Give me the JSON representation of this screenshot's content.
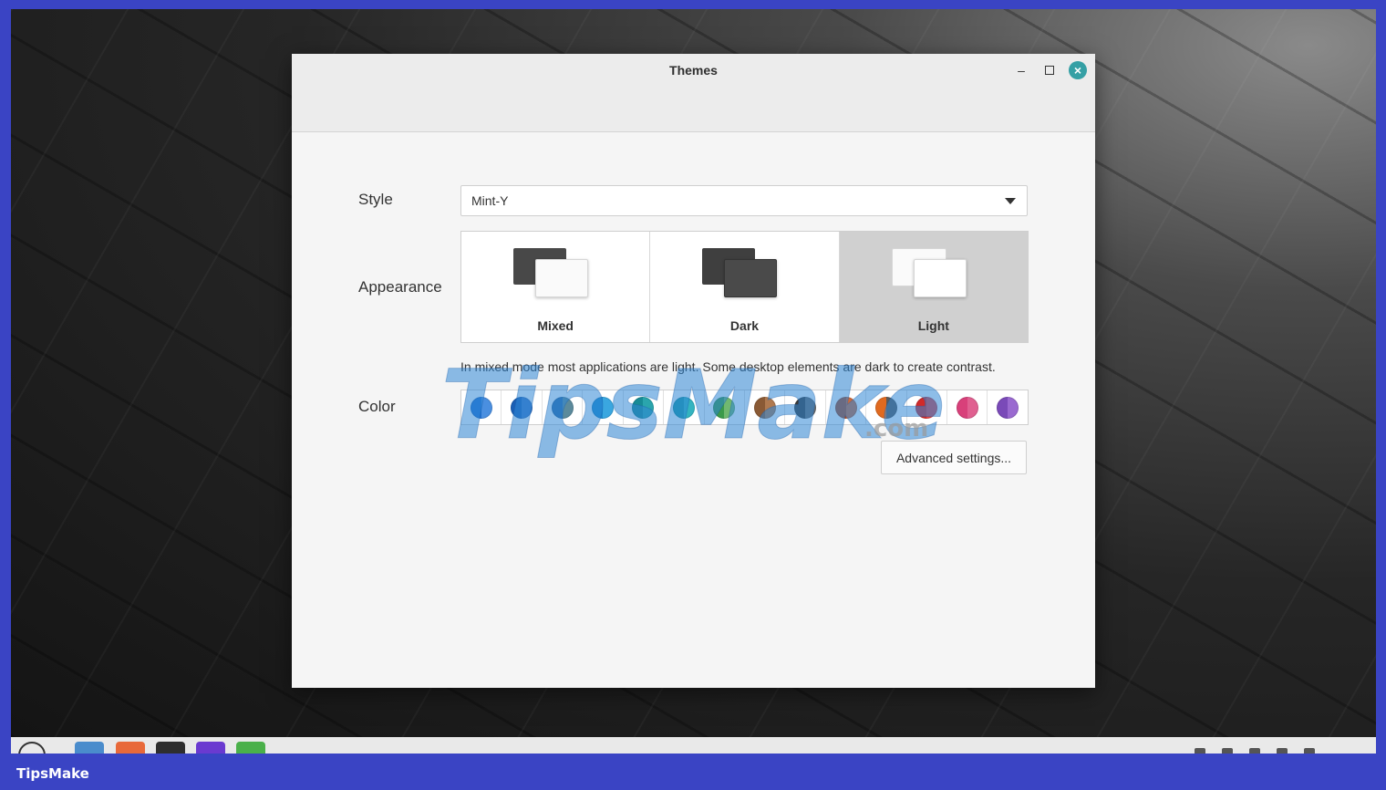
{
  "window": {
    "title": "Themes"
  },
  "style": {
    "label": "Style",
    "selected": "Mint-Y"
  },
  "appearance": {
    "label": "Appearance",
    "options": [
      {
        "label": "Mixed",
        "icon": "mixed-theme-icon"
      },
      {
        "label": "Dark",
        "icon": "dark-theme-icon"
      },
      {
        "label": "Light",
        "icon": "light-theme-icon"
      }
    ],
    "selected": "Light",
    "description": "In mixed mode most applications are light. Some desktop elements are dark to create contrast."
  },
  "color": {
    "label": "Color",
    "swatches": [
      {
        "name": "aqua-blue",
        "a": "#1f6fd0",
        "b": "#4a8fe0"
      },
      {
        "name": "blue",
        "a": "#1a5fb5",
        "b": "#3b78c8"
      },
      {
        "name": "blue-grey",
        "a": "#2a6aa8",
        "b": "#5b8a9c"
      },
      {
        "name": "sky",
        "a": "#1b8ccf",
        "b": "#3aa7e0"
      },
      {
        "name": "teal",
        "a": "#178b96",
        "b": "#2aa5ad"
      },
      {
        "name": "cyan",
        "a": "#1a9aa6",
        "b": "#33b4c0"
      },
      {
        "name": "green",
        "a": "#3a9a4a",
        "b": "#70b870"
      },
      {
        "name": "sand",
        "a": "#8a5a35",
        "b": "#b07a50"
      },
      {
        "name": "grey",
        "a": "#3a3a3a",
        "b": "#6a6a6a"
      },
      {
        "name": "brown",
        "a": "#b04a20",
        "b": "#d06a3a"
      },
      {
        "name": "orange",
        "a": "#e06a20",
        "b": "#5a5a5a"
      },
      {
        "name": "red",
        "a": "#d02a2a",
        "b": "#e04545"
      },
      {
        "name": "pink",
        "a": "#d8407a",
        "b": "#e06090"
      },
      {
        "name": "purple",
        "a": "#7a4ab8",
        "b": "#9a6ad0"
      }
    ]
  },
  "advanced_button": "Advanced settings...",
  "watermark": "TipsMake",
  "watermark_suffix": ".com",
  "footer_brand": "TipsMake"
}
